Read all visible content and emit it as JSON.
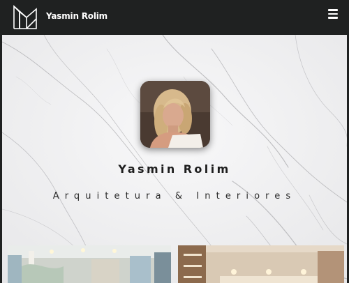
{
  "navbar": {
    "brand": "Yasmin Rolim",
    "logo_icon": "house-monogram-logo",
    "menu_icon": "hamburger-menu-icon"
  },
  "hero": {
    "name": "Yasmin Rolim",
    "subtitle": "Arquitetura & Interiores",
    "background": "white-marble"
  },
  "gallery": {
    "items": [
      {
        "name": "project-thumbnail-kids-room"
      },
      {
        "name": "project-thumbnail-hallway"
      }
    ]
  },
  "colors": {
    "navbar_bg": "#1f2121",
    "brand_text": "#ffffff",
    "heading_text": "#1e1e1e"
  }
}
